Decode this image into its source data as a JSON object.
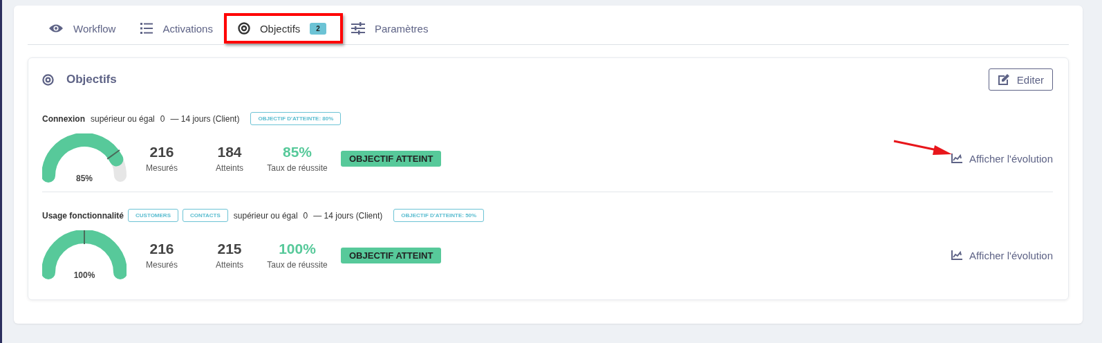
{
  "tabs": [
    {
      "label": "Workflow",
      "selected": false,
      "highlighted": false
    },
    {
      "label": "Activations",
      "selected": false,
      "highlighted": false
    },
    {
      "label": "Objectifs",
      "badge": "2",
      "selected": true,
      "highlighted": true
    },
    {
      "label": "Paramètres",
      "selected": false,
      "highlighted": false
    }
  ],
  "panel": {
    "title": "Objectifs",
    "edit_button": "Editer"
  },
  "goals": [
    {
      "name": "Connexion",
      "condition": "supérieur ou égal",
      "value": "0",
      "period": "— 14 jours (Client)",
      "target": "OBJECTIF D'ATTEINTE: 80%",
      "gauge": {
        "reading": "85%"
      },
      "stats": [
        {
          "value": "216",
          "label": "Mesurés",
          "kind": "count"
        },
        {
          "value": "184",
          "label": "Atteints",
          "kind": "count"
        },
        {
          "value": "85%",
          "label": "Taux de réussite",
          "kind": "rate"
        }
      ],
      "status": "OBJECTIF ATTEINT",
      "link": "Afficher l'évolution",
      "pointer_arrow": true
    },
    {
      "name": "Usage fonctionnalité",
      "tags": [
        "CUSTOMERS",
        "CONTACTS"
      ],
      "condition": "supérieur ou égal",
      "value": "0",
      "period": "— 14 jours (Client)",
      "target": "OBJECTIF D'ATTEINTE: 50%",
      "gauge": {
        "reading": "100%"
      },
      "stats": [
        {
          "value": "216",
          "label": "Mesurés",
          "kind": "count"
        },
        {
          "value": "215",
          "label": "Atteints",
          "kind": "count"
        },
        {
          "value": "100%",
          "label": "Taux de réussite",
          "kind": "rate"
        }
      ],
      "status": "OBJECTIF ATTEINT",
      "link": "Afficher l'évolution",
      "pointer_arrow": false
    }
  ]
}
